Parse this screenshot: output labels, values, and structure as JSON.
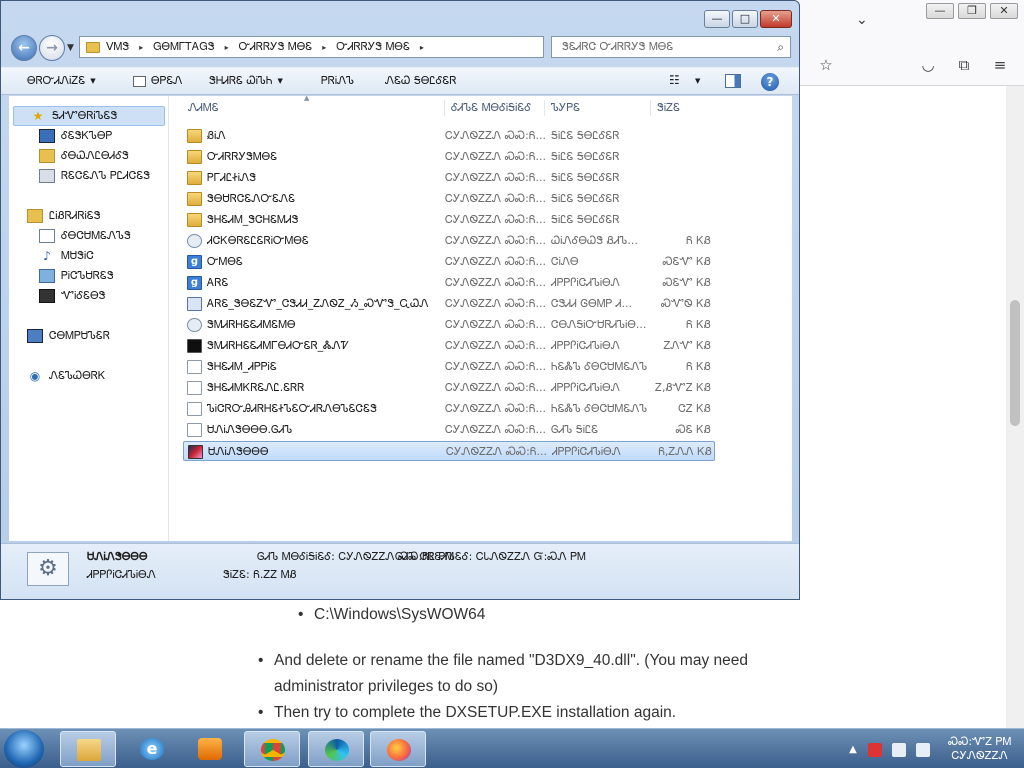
{
  "browser": {
    "buttons": {
      "minimize": "—",
      "restore": "❐",
      "close": "✕",
      "dropdown": "⌄"
    },
    "icons": [
      "star-icon",
      "pocket-icon",
      "extensions-icon",
      "menu-icon"
    ],
    "bullets": {
      "path": "C:\\Windows\\SysWOW64",
      "delete": "And delete or rename the file named \"D3DX9_40.dll\". (You may need",
      "delete2": "administrator privileges to do so)",
      "retry": "Then try to complete the DXSETUP.EXE installation again."
    }
  },
  "explorer": {
    "titlebar": {
      "minimize": "—",
      "maximize": "□",
      "close": "✕"
    },
    "breadcrumb": [
      "ᐯᎷᏕ",
      "ᏀᎾᎷᎱᎢᎪᏀᏕ",
      "ᏅᏗᏒᏒᎩᏕ ᎷᎾᏋ",
      "ᏅᏗᏒᏒᎩᏕ ᎷᎾᏋ"
    ],
    "search_placeholder": "ᏕᏋᏗᏒᏣ ᏅᏗᏒᏒᎩᏕ ᎷᎾᏋ",
    "toolbar": {
      "organize": "ᎾᏒᏅᏗᏁᎥᏃᏋ",
      "open": "ᎾᏢᏋᏁ",
      "share_with": "ᏕᎻᏗᏒᏋ ᏇᎥᏖᏂ",
      "print": "ᏢᏒᎥᏁᏖ",
      "new_folder": "ᏁᏋᏇ ᎦᎾᏝᎴᏋᏒ"
    },
    "nav": {
      "favorites": "ᎦᏗᏉᎾᏒᎥᏖᏋᏕ",
      "desktop": "ᎴᏋᏕᏦᏖᎾᏢ",
      "downloads": "ᎴᎾᏇᏁᏝᎾᏗᎴᏕ",
      "recent": "ᏒᏋᏣᏋᏁᏖ ᏢᏝᏗᏣᏋᏕ",
      "libraries": "ᏝᎥᏰᏒᏗᏒᎥᏋᏕ",
      "documents": "ᎴᎾᏣᏌᎷᏋᏁᏖᏕ",
      "music": "ᎷᏌᏕᎥᏣ",
      "pictures": "ᏢᎥᏣᏖᏌᏒᏋᏕ",
      "videos": "ᏉᎥᎴᏋᎾᏕ",
      "computer": "ᏣᎾᎷᏢᏌᏖᏋᏒ",
      "network": "ᏁᏋᏖᏇᎾᏒᏦ"
    },
    "columns": {
      "name": "ᏁᏗᎷᏋ",
      "date": "ᎴᏗᏖᏋ ᎷᎾᎴᎥᎦᎥᏋᎴ",
      "type": "ᏖᎩᏢᏋ",
      "size": "ᏕᎥᏃᏋ"
    },
    "files": [
      {
        "icon": "folder-icon",
        "name": "ᏰᎥᏁ",
        "date": "ᏟᎩᏁᏫᏃᏃᏁ ᏍᏍ:Ᏺ...",
        "type": "ᎦᎥᏝᏋ ᎦᎾᏝᎴᏋᏒ",
        "size": ""
      },
      {
        "icon": "folder-icon",
        "name": "ᏅᏗᏒᏒᎩᏕᎷᎾᏋ",
        "date": "ᏟᎩᏁᏫᏃᏃᏁ ᏍᏍ:Ᏺ...",
        "type": "ᎦᎥᏝᏋ ᎦᎾᏝᎴᏋᏒ",
        "size": ""
      },
      {
        "icon": "folder-icon",
        "name": "ᏢᎱᏗᏝᏐᎥᏁᏕ",
        "date": "ᏟᎩᏁᏫᏃᏃᏁ ᏍᏍ:Ᏺ...",
        "type": "ᎦᎥᏝᏋ ᎦᎾᏝᎴᏋᏒ",
        "size": ""
      },
      {
        "icon": "folder-icon",
        "name": "ᏕᎾᏌᏒᏣᏋᏁᏅᏋᏁᏋ",
        "date": "ᏟᎩᏁᏫᏃᏃᏁ ᏍᏍ:Ᏺ...",
        "type": "ᎦᎥᏝᏋ ᎦᎾᏝᎴᏋᏒ",
        "size": ""
      },
      {
        "icon": "folder-icon",
        "name": "ᏕᎻᏋᏗᎷ_ᏕᏣᎻᏋᎷᏗᏕ",
        "date": "ᏟᎩᏁᏫᏃᏃᏁ ᏍᏍ:Ᏺ...",
        "type": "ᎦᎥᏝᏋ ᎦᎾᏝᎴᏋᏒ",
        "size": ""
      },
      {
        "icon": "settings-file-icon",
        "name": "ᏗᏣᏦᎾᏒᏋᏝᏋᏒᎥᏅᎷᎾᏋ",
        "date": "ᏟᎩᏁᏫᏃᏃᏁ ᏍᏍ:Ᏺ...",
        "type": "ᏇᎥᏁᎴᎾᏇᏕ ᏰᏗᏖ...",
        "size": "Ᏺ ᏦᏰ"
      },
      {
        "icon": "gm-icon",
        "name": "ᏅᎷᎾᏋ",
        "date": "ᏟᎩᏁᏫᏃᏃᏁ ᏍᏍ:Ᏺ...",
        "type": "ᏣᎥᏁᎾ",
        "size": "ᏍᏋᏉ ᏦᏰ"
      },
      {
        "icon": "gm-icon",
        "name": "ᎪᏒᏋ",
        "date": "ᏟᎩᏁᏫᏃᏃᏁ ᏍᏍ:Ᏺ...",
        "type": "ᏗᏢᏢᎵᎥᏣᏗᏖᎥᎾᏁ",
        "size": "ᏍᏋᏉ ᏦᏰ"
      },
      {
        "icon": "exe-icon",
        "name": "ᎪᏒᏋ_ᏕᎾᏋᏃᏉ_ᏣᏕᏗᏗ_ᏃᏁᏫᏃ_Ᏹ_ᏍᏉᏕ_ᏩᏇᏁ",
        "date": "ᏟᎩᏁᏫᏃᏃᏁ ᏍᏍ:Ᏺ...",
        "type": "ᏣᏕᏗᏗ ᎶᎾᎷᏢ Ꮧ...",
        "size": "ᏍᏉᏫ ᏦᏰ"
      },
      {
        "icon": "settings-file-icon",
        "name": "ᏕᎷᏗᏒᎻᏋᏋᏗᎷᏋᎷᎾ",
        "date": "ᏟᎩᏁᏫᏃᏃᏁ ᏍᏍ:Ᏺ...",
        "type": "ᏣᎾᏁᎦᎥᏅᏌᏒᏗᏖᎥᎾ...",
        "size": "Ᏺ ᏦᏰ"
      },
      {
        "icon": "terminal-icon",
        "name": "ᏕᎷᏗᏒᎻᏋᏋᏗᎷᎱᎾᏗᏅᏋᏒ_ᏜᏁᏤ",
        "date": "ᏟᎩᏁᏫᏃᏃᏁ ᏍᏍ:Ᏺ...",
        "type": "ᏗᏢᏢᎵᎥᏣᏗᏖᎥᎾᏁ",
        "size": "ᏃᏁᏉ ᏦᏰ"
      },
      {
        "icon": "file-icon",
        "name": "ᏕᎻᏋᏗᎷ_ᏗᏢᏢᎥᏋ",
        "date": "ᏟᎩᏁᏫᏃᏃᏁ ᏍᏍ:Ᏺ...",
        "type": "ᏂᏋᏜᏖ ᎴᎾᏣᏌᎷᏋᏁᏖ",
        "size": "Ᏺ ᏦᏰ"
      },
      {
        "icon": "file-icon",
        "name": "ᏕᎻᏋᏗᎷᏦᏒᏋᏁᏝ.ᏋᏒᏒ",
        "date": "ᏟᎩᏁᏫᏃᏃᏁ ᏍᏍ:Ᏺ...",
        "type": "ᏗᏢᏢᎵᎥᏣᏗᏖᎥᎾᏁ",
        "size": "Ꮓ,ᏰᏉᏃ ᏦᏰ"
      },
      {
        "icon": "file-icon",
        "name": "ᏖᎥᏣᏒᏅᎯᏗᏒᎻᏋᏐᏖᏋᏅᏗᏒᏁᎾᏖᏋᏣᏋᏕ",
        "date": "ᏟᎩᏁᏫᏃᏃᏁ ᏍᏍ:Ᏺ...",
        "type": "ᏂᏋᏜᏖ ᎴᎾᏣᏌᎷᏋᏁᏖ",
        "size": "ᏣᏃ ᏦᏰ"
      },
      {
        "icon": "file-icon",
        "name": "ᏌᏁᎥᏁᏕᎾᎾᎾ.ᎶᏗᏖ",
        "date": "ᏟᎩᏁᏫᏃᏃᏁ ᏍᏍ:Ᏺ...",
        "type": "ᎶᏗᏖ ᎦᎥᏝᏋ",
        "size": "ᏍᏋ ᏦᏰ"
      },
      {
        "icon": "app-icon",
        "name": "ᏌᏁᎥᏁᏕᎾᎾᎾ",
        "date": "ᏟᎩᏁᏫᏃᏃᏁ ᏍᏍ:Ᏺ...",
        "type": "ᏗᏢᏢᎵᎥᏣᏗᏖᎥᎾᏁ",
        "size": "Ᏺ,ᏃᏁᏁ ᏦᏰ"
      }
    ],
    "details": {
      "name": "ᏌᏁᎥᏁᏕᎾᎾᎾ",
      "modified": "ᎶᏗᏖ ᎷᎾᎴᎥᎦᎥᏋᎴ: ᏟᎩᏁᏫᏃᏃᏁ ᏍᏍ:ᏲᏝ ᏢᎷ",
      "created": "ᎶᏗᏖ ᏣᏒᏋᏗᏖᏋᎴ: ᏟᏓᏁᏫᏃᏃᏁ Ᏻ:ᏍᏁ ᏢᎷ",
      "type": "ᏗᏢᏢᎵᎥᏣᏗᏖᎥᎾᏁ",
      "size": "ᏕᎥᏃᏋ: Ᏺ.ᏃᏃ ᎷᏰ"
    }
  },
  "taskbar": {
    "time": "ᏍᏍ:ᏉᏃ ᏢᎷ",
    "date": "ᏟᎩᏁᏫᏃᏃᏁ"
  }
}
